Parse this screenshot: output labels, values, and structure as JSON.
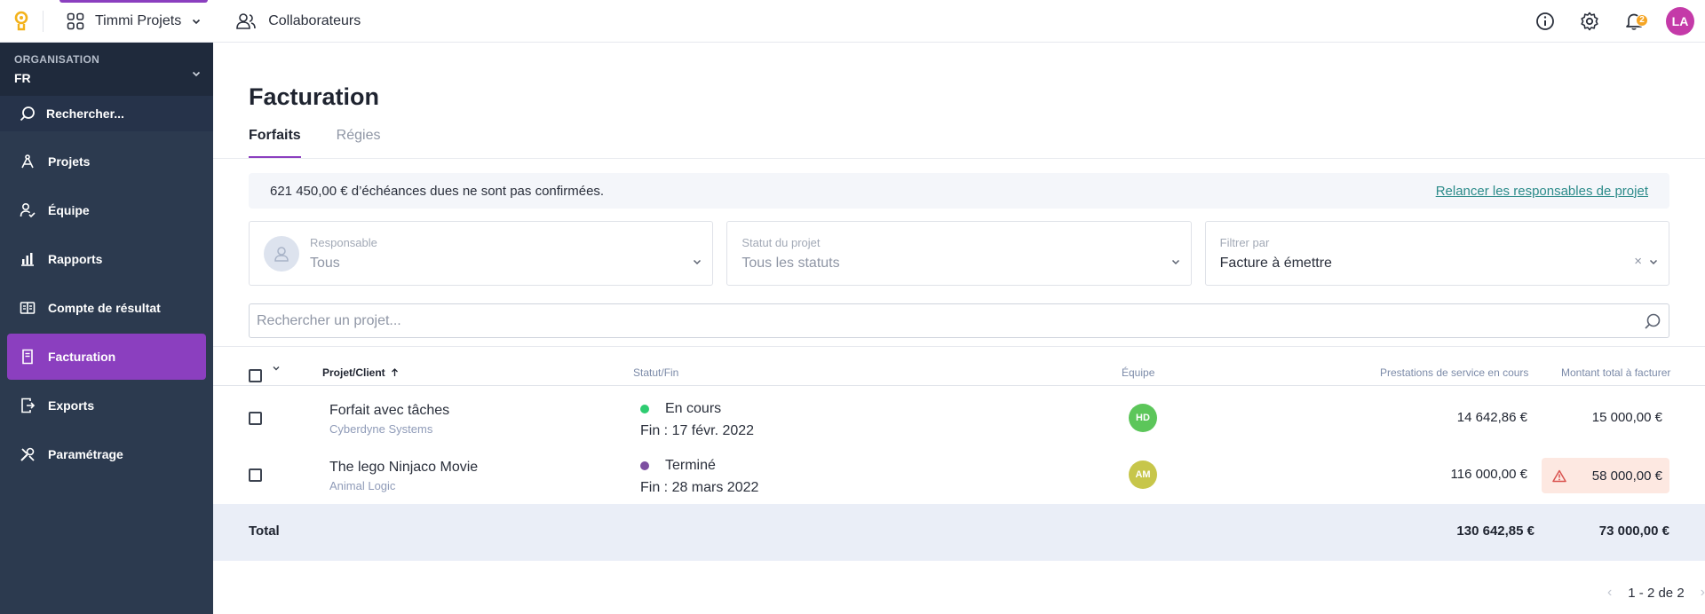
{
  "topbar": {
    "logo_icon": "lightbulb-logo-icon",
    "app_switch_label": "Timmi Projets",
    "collab_label": "Collaborateurs",
    "notif_count": "2",
    "user_initials": "LA",
    "accent": "#8b3fbf"
  },
  "sidebar": {
    "org_label": "ORGANISATION",
    "org_value": "FR",
    "search_label": "Rechercher...",
    "items": [
      {
        "label": "Projets",
        "icon": "compass-icon"
      },
      {
        "label": "Équipe",
        "icon": "team-icon"
      },
      {
        "label": "Rapports",
        "icon": "bar-chart-icon"
      },
      {
        "label": "Compte de résultat",
        "icon": "ledger-icon"
      },
      {
        "label": "Facturation",
        "icon": "invoice-icon",
        "active": true
      },
      {
        "label": "Exports",
        "icon": "export-icon"
      },
      {
        "label": "Paramétrage",
        "icon": "tools-icon"
      }
    ]
  },
  "main": {
    "title": "Facturation",
    "tabs": [
      {
        "label": "Forfaits",
        "active": true
      },
      {
        "label": "Régies"
      }
    ],
    "alert_text": "621 450,00 € d’échéances dues ne sont pas confirmées.",
    "alert_link": "Relancer les responsables de projet",
    "filters": {
      "responsable": {
        "label": "Responsable",
        "value": "Tous"
      },
      "statut": {
        "label": "Statut du projet",
        "value": "Tous les statuts"
      },
      "filtrer": {
        "label": "Filtrer par",
        "value": "Facture à émettre",
        "clear": "×"
      }
    },
    "search_placeholder": "Rechercher un projet...",
    "columns": {
      "projet": "Projet/Client",
      "statut": "Statut/Fin",
      "equipe": "Équipe",
      "prestations": "Prestations de service en cours",
      "montant": "Montant total à facturer"
    },
    "rows": [
      {
        "name": "Forfait avec tâches",
        "client": "Cyberdyne Systems",
        "status": "En cours",
        "status_color": "#2ecc71",
        "end": "Fin : 17 févr. 2022",
        "team": "HD",
        "team_color": "#5cc65a",
        "prestations": "14 642,86 €",
        "montant": "15 000,00 €",
        "warning": false
      },
      {
        "name": "The lego Ninjaco Movie",
        "client": "Animal Logic",
        "status": "Terminé",
        "status_color": "#7d4fa1",
        "end": "Fin : 28 mars 2022",
        "team": "AM",
        "team_color": "#c7c64a",
        "prestations": "116 000,00 €",
        "montant": "58 000,00 €",
        "warning": true
      }
    ],
    "total": {
      "label": "Total",
      "prestations": "130 642,85 €",
      "montant": "73 000,00 €"
    },
    "pager": "1 - 2 de 2"
  }
}
